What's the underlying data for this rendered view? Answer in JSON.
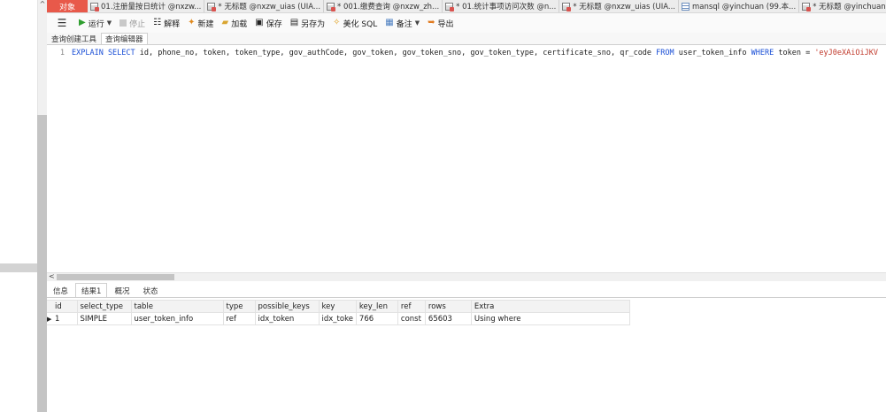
{
  "object_tab": "对象",
  "query_tabs": [
    {
      "label": "01.注册量按日统计 @nxzw...",
      "icon": "query"
    },
    {
      "label": "* 无标题 @nxzw_uias (UIA...",
      "icon": "query"
    },
    {
      "label": "* 001.缴费查询 @nxzw_zh...",
      "icon": "query"
    },
    {
      "label": "* 01.统计事项访问次数 @n...",
      "icon": "query"
    },
    {
      "label": "* 无标题 @nxzw_uias (UIA...",
      "icon": "query"
    },
    {
      "label": "mansql @yinchuan (99.本...",
      "icon": "table"
    },
    {
      "label": "* 无标题 @yinchuan (99.本...",
      "icon": "query"
    },
    {
      "label": "* 无标题",
      "icon": "query"
    }
  ],
  "toolbar": {
    "run": "运行",
    "stop": "停止",
    "explain": "解释",
    "new": "新建",
    "load": "加载",
    "save": "保存",
    "save_as": "另存为",
    "beautify": "美化 SQL",
    "comment": "备注",
    "export": "导出"
  },
  "subtabs": [
    "查询创建工具",
    "查询编辑器"
  ],
  "editor": {
    "line_number": "1",
    "kw_explain_select": "EXPLAIN SELECT",
    "columns": " id, phone_no, token, token_type, gov_authCode, gov_token, gov_token_sno, gov_token_type, certificate_sno, qr_code ",
    "kw_from": "FROM",
    "table": " user_token_info ",
    "kw_where": "WHERE",
    "condition": " token = ",
    "string_value": "'eyJ0eXAiOiJKV"
  },
  "result_tabs": [
    "信息",
    "结果1",
    "概况",
    "状态"
  ],
  "result_table": {
    "columns": [
      "id",
      "select_type",
      "table",
      "type",
      "possible_keys",
      "key",
      "key_len",
      "ref",
      "rows",
      "Extra"
    ],
    "rows": [
      [
        "1",
        "SIMPLE",
        "user_token_info",
        "ref",
        "idx_token",
        "idx_toke",
        "766",
        "const",
        "65603",
        "Using where"
      ]
    ]
  }
}
